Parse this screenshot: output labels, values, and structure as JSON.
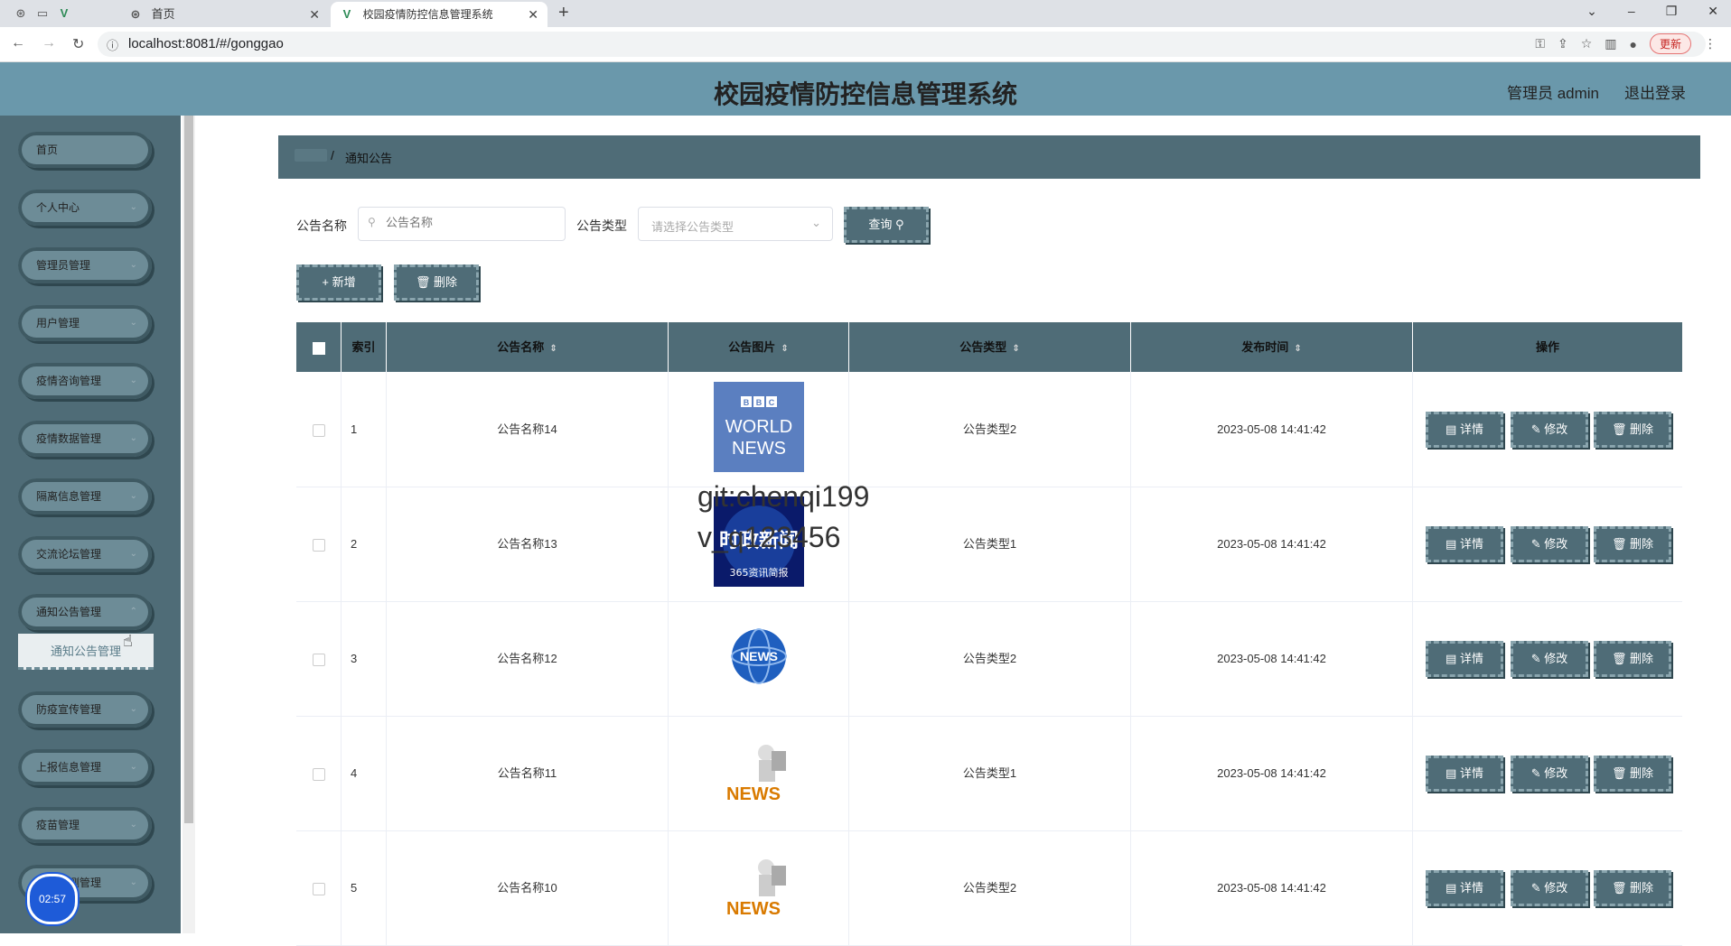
{
  "browser": {
    "tabs": [
      {
        "title": "首页"
      },
      {
        "title": "校园疫情防控信息管理系统"
      }
    ],
    "url": "localhost:8081/#/gonggao",
    "update_label": "更新"
  },
  "header": {
    "title": "校园疫情防控信息管理系统",
    "user": "管理员 admin",
    "logout": "退出登录"
  },
  "sidebar": {
    "items": [
      {
        "label": "首页"
      },
      {
        "label": "个人中心"
      },
      {
        "label": "管理员管理"
      },
      {
        "label": "用户管理"
      },
      {
        "label": "疫情咨询管理"
      },
      {
        "label": "疫情数据管理"
      },
      {
        "label": "隔离信息管理"
      },
      {
        "label": "交流论坛管理"
      },
      {
        "label": "通知公告管理"
      },
      {
        "label": "防疫宣传管理"
      },
      {
        "label": "上报信息管理"
      },
      {
        "label": "疫苗管理"
      },
      {
        "label": "核酸检测管理"
      }
    ],
    "sub_item": "通知公告管理",
    "time": "02:57"
  },
  "breadcrumb": {
    "separator": "/",
    "current": "通知公告"
  },
  "search": {
    "name_label": "公告名称",
    "name_placeholder": "公告名称",
    "type_label": "公告类型",
    "type_placeholder": "请选择公告类型",
    "query_button": "查询 ⚲"
  },
  "toolbar": {
    "add_button": "+ 新增",
    "delete_button": "🗑 删除"
  },
  "table": {
    "columns": [
      "索引",
      "公告名称",
      "公告图片",
      "公告类型",
      "发布时间",
      "操作"
    ],
    "rows": [
      {
        "index": "1",
        "name": "公告名称14",
        "image": "BBC WORLD NEWS",
        "type": "公告类型2",
        "time": "2023-05-08 14:41:42"
      },
      {
        "index": "2",
        "name": "公告名称13",
        "image": "时政新闻 365资讯简报",
        "type": "公告类型1",
        "time": "2023-05-08 14:41:42"
      },
      {
        "index": "3",
        "name": "公告名称12",
        "image": "NEWS",
        "type": "公告类型2",
        "time": "2023-05-08 14:41:42"
      },
      {
        "index": "4",
        "name": "公告名称11",
        "image": "NEWS",
        "type": "公告类型1",
        "time": "2023-05-08 14:41:42"
      },
      {
        "index": "5",
        "name": "公告名称10",
        "image": "NEWS",
        "type": "公告类型2",
        "time": "2023-05-08 14:41:42"
      }
    ],
    "actions": {
      "detail": "▤ 详情",
      "edit": "✎ 修改",
      "delete": "🗑 删除"
    }
  },
  "watermark": {
    "line1": "git:chenqi199",
    "line2": "v_q123456"
  },
  "colors": {
    "header": "#6a98ab",
    "primary": "#4f6c77",
    "sidebar": "#4f6c77"
  }
}
